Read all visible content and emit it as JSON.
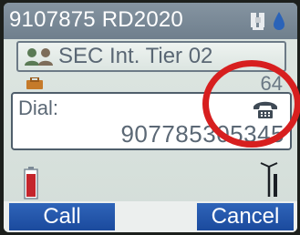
{
  "status_bar": {
    "title": "9107875 RD2020",
    "icons": [
      "gps-icon",
      "water-drop-icon"
    ]
  },
  "contact": {
    "label": "SEC Int. Tier 02",
    "icon": "group-icon"
  },
  "call_info": {
    "count": "64"
  },
  "dial": {
    "label": "Dial:",
    "number": "907785305345",
    "icon": "phone-icon"
  },
  "softkeys": {
    "left": "Call",
    "right": "Cancel"
  },
  "colors": {
    "status_bar": "#7a8998",
    "softkey": "#244fa6",
    "annotation": "#d71f1f",
    "battery_low": "#c4252c"
  }
}
